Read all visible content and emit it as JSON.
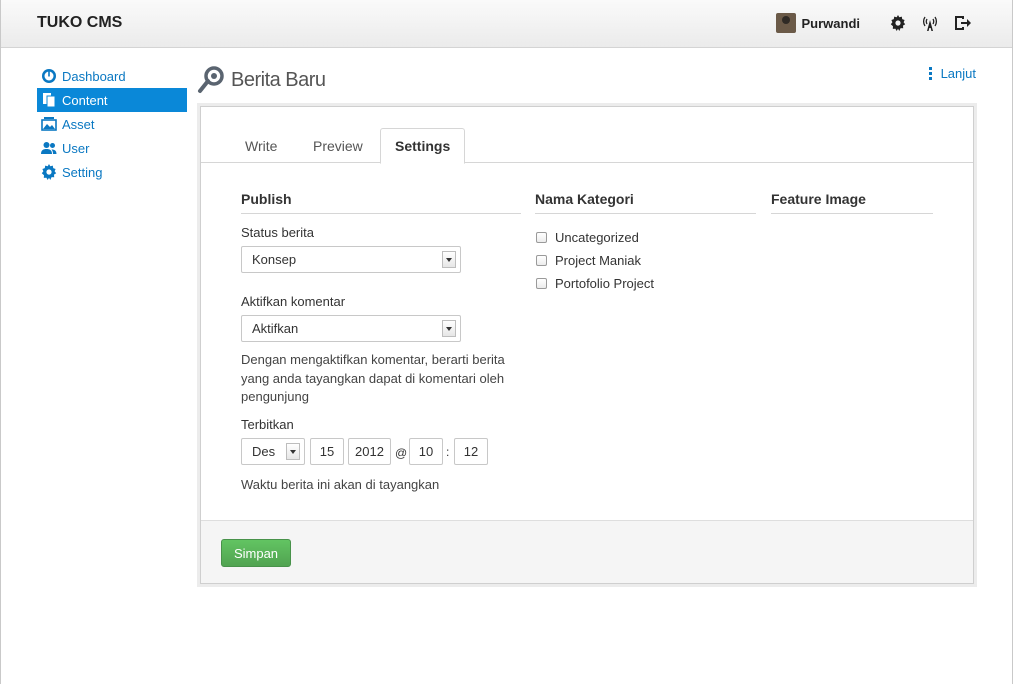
{
  "app": {
    "brand": "TUKO CMS"
  },
  "user": {
    "name": "Purwandi"
  },
  "sidebar": {
    "items": [
      {
        "label": "Dashboard",
        "icon": "dashboard-icon"
      },
      {
        "label": "Content",
        "icon": "content-icon",
        "active": true
      },
      {
        "label": "Asset",
        "icon": "asset-icon"
      },
      {
        "label": "User",
        "icon": "user-icon"
      },
      {
        "label": "Setting",
        "icon": "setting-icon"
      }
    ]
  },
  "page": {
    "title": "Berita Baru",
    "more_label": "Lanjut"
  },
  "tabs": [
    "Write",
    "Preview",
    "Settings"
  ],
  "publish": {
    "heading": "Publish",
    "status_label": "Status berita",
    "status_value": "Konsep",
    "comment_label": "Aktifkan komentar",
    "comment_value": "Aktifkan",
    "comment_help": "Dengan mengaktifkan komentar, berarti berita yang anda tayangkan dapat di komentari oleh pengunjung",
    "publish_label": "Terbitkan",
    "month": "Des",
    "day": "15",
    "year": "2012",
    "at_sign": "@",
    "hour": "10",
    "colon": ":",
    "minute": "12",
    "publish_help": "Waktu berita ini akan di tayangkan"
  },
  "categories": {
    "heading": "Nama Kategori",
    "items": [
      "Uncategorized",
      "Project Maniak",
      "Portofolio Project"
    ]
  },
  "feature_image": {
    "heading": "Feature Image"
  },
  "actions": {
    "save_label": "Simpan"
  },
  "colors": {
    "accent": "#0a88d8",
    "link": "#0a78c2",
    "save": "#5bb75b"
  }
}
